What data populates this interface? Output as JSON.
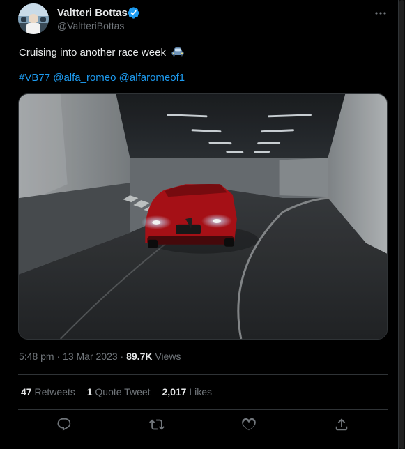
{
  "author": {
    "name": "Valtteri Bottas",
    "handle": "@ValtteriBottas"
  },
  "tweet": {
    "text": "Cruising into another race week",
    "hashtags": [
      "#VB77",
      "@alfa_romeo",
      "@alfaromeof1"
    ],
    "time": "5:48 pm",
    "separator": "·",
    "date": "13 Mar 2023",
    "views_count": "89.7K",
    "views_label": "Views"
  },
  "stats": {
    "retweets_count": "47",
    "retweets_label": "Retweets",
    "quote_count": "1",
    "quote_label": "Quote Tweet",
    "likes_count": "2,017",
    "likes_label": "Likes"
  },
  "colors": {
    "background": "#000000",
    "text": "#e7e9ea",
    "muted": "#71767b",
    "link": "#1d9bf0",
    "divider": "#2f3336",
    "car": "#c4161c"
  },
  "icons": [
    "verified-badge-icon",
    "more-options-icon",
    "car-emoji-icon",
    "reply-icon",
    "retweet-icon",
    "like-icon",
    "share-icon"
  ]
}
